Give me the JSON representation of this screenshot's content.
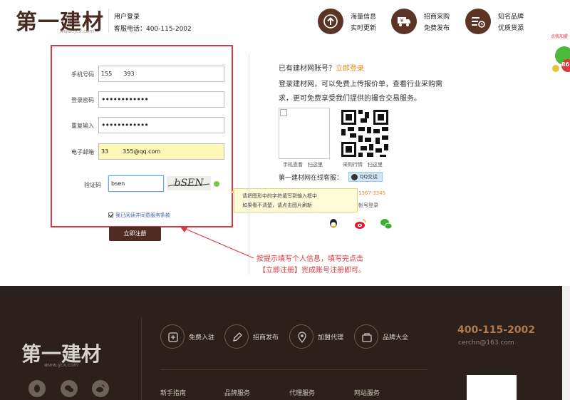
{
  "header": {
    "logo_text": "第一建材",
    "logo_url": "www.ijcx.com",
    "login_title": "用户登录",
    "service_phone": "客服电话：400-115-2002",
    "features": [
      {
        "line1": "海量信息",
        "line2": "实时更新",
        "icon": "upload-icon"
      },
      {
        "line1": "招商采购",
        "line2": "免费发布",
        "icon": "truck-money-icon"
      },
      {
        "line1": "知名品牌",
        "line2": "优质货源",
        "icon": "list-clock-icon"
      }
    ]
  },
  "form": {
    "phone_label": "手机号码",
    "phone_value": "155    393",
    "password_label": "登录密码",
    "password_value": "••••••••••••",
    "repeat_label": "重复输入",
    "repeat_value": "••••••••••••",
    "email_label": "电子邮箱",
    "email_value": "33     355@qq.com",
    "captcha_label": "验证码",
    "captcha_value": "bsen",
    "captcha_image_text": "bSEN",
    "tooltip_line1": "请把图形中的字符填写到输入框中",
    "tooltip_line2": "如果看不清楚，请点击图片刷新",
    "agree_text": "我已阅读并同意服务条款",
    "register_button": "立即注册"
  },
  "side": {
    "has_account": "已有建材网账号？",
    "login_link": "立即登录",
    "intro": "登录建材网，可以免费上传报价单，查看行业采购需求，更可免费享受我们提供的撮合交易服务。",
    "qr1_caption": "手机查看　扫这里",
    "qr2_caption": "采购行情　扫这里",
    "online_service": "第一建材网在线客服：",
    "qq_button": "QQ交谈",
    "phone_partial": "1367-3345",
    "other_login": "帐号登录"
  },
  "annotation": {
    "line1": "按提示填写个人信息，填写完点击",
    "line2": "【立即注册】完成账号注册即可。"
  },
  "float_ad": {
    "text": "点我加盟",
    "number": "86"
  },
  "footer": {
    "logo_text": "第一建材",
    "logo_url": "www.ijcx.com",
    "items": [
      {
        "label": "免费入驻",
        "icon": "store-icon"
      },
      {
        "label": "招商发布",
        "icon": "edit-icon"
      },
      {
        "label": "加盟代理",
        "icon": "location-icon"
      },
      {
        "label": "品牌大全",
        "icon": "bag-icon"
      }
    ],
    "phone": "400-115-2002",
    "email": "cerchn@163.com",
    "nav": [
      "新手指南",
      "品牌服务",
      "代理服务",
      "网站服务"
    ]
  },
  "colors": {
    "brand_brown": "#4e2c1f",
    "accent_red": "#d8383f",
    "accent_orange": "#e98a2a",
    "footer_bg": "#2b201b"
  }
}
